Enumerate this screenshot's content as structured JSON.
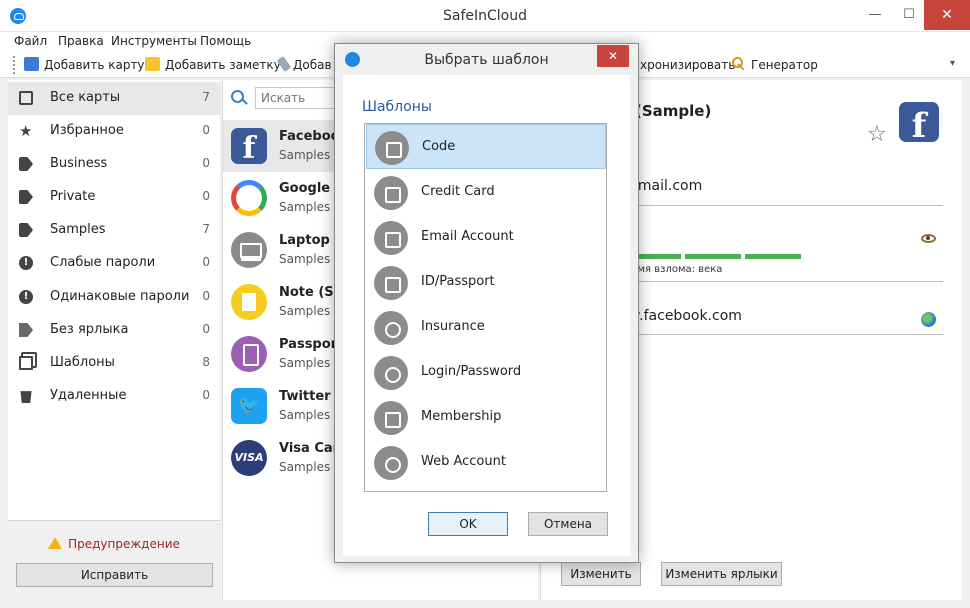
{
  "window": {
    "title": "SafeInCloud"
  },
  "menu": [
    "Файл",
    "Правка",
    "Инструменты",
    "Помощь"
  ],
  "toolbar": {
    "add_card": "Добавить карту",
    "add_note": "Добавить заметку",
    "add_file": "Добав",
    "sync": "хронизировать",
    "generator": "Генератор"
  },
  "sidebar": {
    "items": [
      {
        "label": "Все карты",
        "count": "7",
        "icon": "cards-icon"
      },
      {
        "label": "Избранное",
        "count": "0",
        "icon": "star-icon"
      },
      {
        "label": "Business",
        "count": "0",
        "icon": "tag-icon"
      },
      {
        "label": "Private",
        "count": "0",
        "icon": "tag-icon"
      },
      {
        "label": "Samples",
        "count": "7",
        "icon": "tag-icon"
      },
      {
        "label": "Слабые пароли",
        "count": "0",
        "icon": "alert-icon"
      },
      {
        "label": "Одинаковые пароли",
        "count": "0",
        "icon": "alert-icon"
      },
      {
        "label": "Без ярлыка",
        "count": "0",
        "icon": "no-tag-icon"
      },
      {
        "label": "Шаблоны",
        "count": "8",
        "icon": "templates-icon"
      },
      {
        "label": "Удаленные",
        "count": "0",
        "icon": "trash-icon"
      }
    ],
    "warning": "Предупреждение",
    "fix_button": "Исправить"
  },
  "search": {
    "placeholder": "Искать"
  },
  "cards": [
    {
      "title": "Facebook",
      "sub": "Samples"
    },
    {
      "title": "Google (S",
      "sub": "Samples"
    },
    {
      "title": "Laptop (S",
      "sub": "Samples"
    },
    {
      "title": "Note (Sar",
      "sub": "Samples"
    },
    {
      "title": "Passport",
      "sub": "Samples"
    },
    {
      "title": "Twitter (S",
      "sub": "Samples"
    },
    {
      "title": "Visa Card",
      "sub": "Samples"
    }
  ],
  "detail": {
    "title": "(Sample)",
    "email": "gmail.com",
    "crack_time": "ремя взлома: века",
    "website": "w.facebook.com",
    "edit_button": "Изменить",
    "edit_labels_button": "Изменить ярлыки",
    "logo_letter": "f"
  },
  "dialog": {
    "title": "Выбрать шаблон",
    "heading": "Шаблоны",
    "templates": [
      {
        "label": "Code",
        "icon": "lock-icon"
      },
      {
        "label": "Credit Card",
        "icon": "credit-card-icon"
      },
      {
        "label": "Email Account",
        "icon": "envelope-icon"
      },
      {
        "label": "ID/Passport",
        "icon": "id-card-icon"
      },
      {
        "label": "Insurance",
        "icon": "umbrella-icon"
      },
      {
        "label": "Login/Password",
        "icon": "key-icon"
      },
      {
        "label": "Membership",
        "icon": "handshake-icon"
      },
      {
        "label": "Web Account",
        "icon": "globe-icon"
      }
    ],
    "ok_button": "OK",
    "cancel_button": "Отмена"
  },
  "colors": {
    "accent": "#1e88e5",
    "close_red": "#c7453b",
    "selected_bg": "#cce4f7",
    "strength_green": "#4caf50",
    "warning_text": "#a0281e"
  }
}
